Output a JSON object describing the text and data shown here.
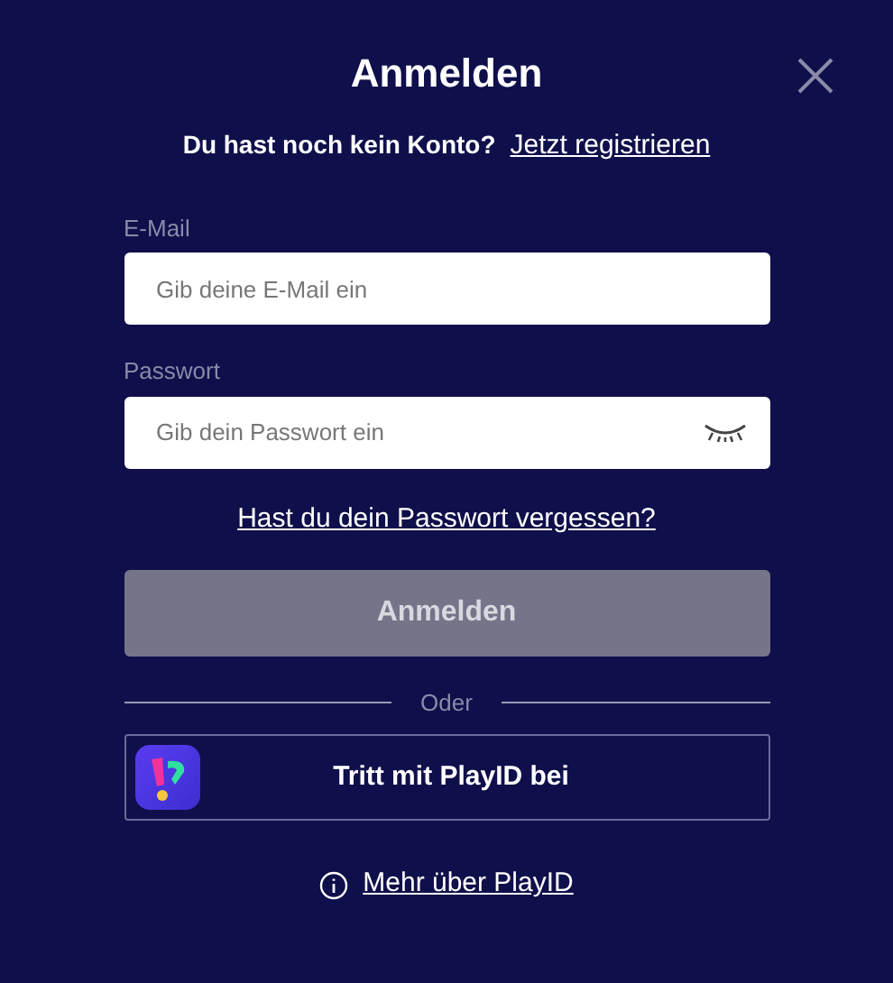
{
  "title": "Anmelden",
  "signup": {
    "prompt": "Du hast noch kein Konto?",
    "link": "Jetzt registrieren"
  },
  "fields": [
    {
      "label": "E-Mail",
      "placeholder": "Gib deine E-Mail ein",
      "kind": "email"
    },
    {
      "label": "Passwort",
      "placeholder": "Gib dein Passwort ein",
      "kind": "password"
    }
  ],
  "forgot_link": "Hast du dein Passwort vergessen?",
  "submit": {
    "label": "Anmelden",
    "disabled": true
  },
  "divider": "Oder",
  "playid_button": "Tritt mit PlayID bei",
  "info_link": "Mehr über PlayID"
}
